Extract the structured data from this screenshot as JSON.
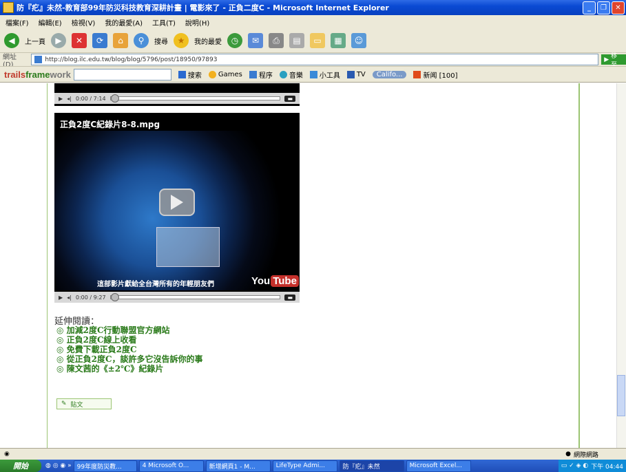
{
  "window": {
    "title": "防『疕』未然-教育部99年防災科技教育深耕計畫 | 電影來了 - 正負二度C - Microsoft Internet Explorer"
  },
  "menu": [
    "檔案(F)",
    "編輯(E)",
    "檢視(V)",
    "我的最愛(A)",
    "工具(T)",
    "說明(H)"
  ],
  "toolbar": {
    "back": "上一頁",
    "search": "搜尋",
    "favorites": "我的最愛"
  },
  "address": {
    "label": "網址(D)",
    "url": "http://blog.ilc.edu.tw/blog/blog/5796/post/18950/97893",
    "go": "移至"
  },
  "trails": {
    "brand_a": "trails",
    "brand_b": "frame",
    "brand_c": "work",
    "search_btn": "搜索",
    "games": "Games",
    "programs": "程序",
    "music": "音樂",
    "tools": "小工具",
    "tv": "TV",
    "location": "Califo...",
    "news": "新闻 [100]"
  },
  "video1": {
    "time": "0:00 / 7:14"
  },
  "video2": {
    "title": "正負2度C紀錄片8-8.mpg",
    "slogan": "這部影片獻給全台灣所有的年輕朋友們",
    "yt_you": "You",
    "yt_tube": "Tube",
    "time": "0:00 / 9:27"
  },
  "extended": {
    "heading": "延伸閱讀：",
    "items": [
      "◎ 加減2度C行動聯盟官方網站",
      "◎ 正負2度C線上收看",
      "◎ 免費下載正負2度C",
      "◎ 從正負2度C，談許多它沒告訴你的事",
      "◎ 陳文茜的《±2℃》紀錄片"
    ],
    "reply": "貼文"
  },
  "status": {
    "zone": "網際網路"
  },
  "taskbar": {
    "start": "開始",
    "tasks": [
      "99年度防災教...",
      "4 Microsoft O...",
      "新增網頁1 - M...",
      "LifeType Admi...",
      "防『疕』未然",
      "Microsoft Excel..."
    ],
    "clock": "下午 04:44"
  },
  "colors": {
    "accent_green": "#2a7a1a",
    "frame_green": "#9bc472",
    "title_blue": "#0a4ad3"
  }
}
